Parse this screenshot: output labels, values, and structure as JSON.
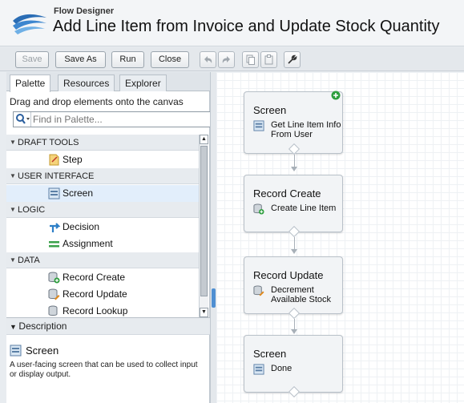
{
  "header": {
    "app_name": "Flow Designer",
    "flow_title": "Add Line Item from Invoice and Update Stock Quantity"
  },
  "toolbar": {
    "save": "Save",
    "save_as": "Save As",
    "run": "Run",
    "close": "Close"
  },
  "palette": {
    "tabs": [
      "Palette",
      "Resources",
      "Explorer"
    ],
    "hint": "Drag and drop elements onto the canvas",
    "search_placeholder": "Find in Palette...",
    "sections": [
      {
        "label": "DRAFT TOOLS",
        "items": [
          "Step"
        ]
      },
      {
        "label": "USER INTERFACE",
        "items": [
          "Screen"
        ]
      },
      {
        "label": "LOGIC",
        "items": [
          "Decision",
          "Assignment"
        ]
      },
      {
        "label": "DATA",
        "items": [
          "Record Create",
          "Record Update",
          "Record Lookup"
        ]
      }
    ],
    "selected_item": "Screen"
  },
  "description": {
    "header": "Description",
    "name": "Screen",
    "text": "A user-facing screen that can be used to collect input or display output."
  },
  "canvas": {
    "nodes": [
      {
        "type": "Screen",
        "label": "Get Line Item Info From User",
        "start": true
      },
      {
        "type": "Record Create",
        "label": "Create Line Item"
      },
      {
        "type": "Record Update",
        "label": "Decrement Available Stock"
      },
      {
        "type": "Screen",
        "label": "Done"
      }
    ]
  },
  "colors": {
    "accent": "#4f8fd2",
    "start_badge": "#2e9e3e",
    "selection": "#e2eefb"
  }
}
